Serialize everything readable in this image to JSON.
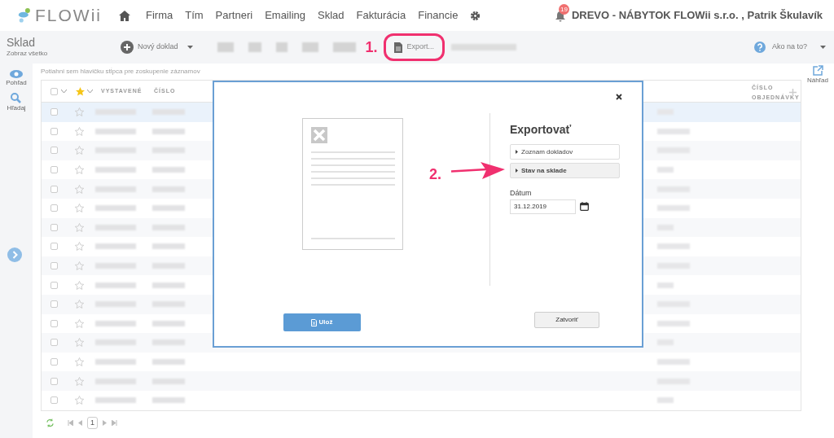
{
  "nav": {
    "logo": "FLOWii",
    "items": [
      "Firma",
      "Tím",
      "Partneri",
      "Emailing",
      "Sklad",
      "Fakturácia",
      "Financie"
    ],
    "notification_count": "19",
    "user": "DREVO - NÁBYTOK FLOWii s.r.o. , Patrik Škulavík"
  },
  "toolbar": {
    "title": "Sklad",
    "subtitle": "Zobraz všetko",
    "new_button": "Nový doklad",
    "export_button": "Export...",
    "help": "Ako na to?"
  },
  "left_rail": [
    "Pohľad",
    "Hľadaj"
  ],
  "right_rail": "Náhľad",
  "table": {
    "group_hint": "Potiahni sem hlavičku stĺpca pre zoskupenie záznamov",
    "columns": [
      "VYSTAVENÉ",
      "ČÍSLO"
    ],
    "last_column": [
      "ČÍSLO",
      "OBJEDNÁVKY"
    ],
    "rows": [
      {
        "selected": true,
        "checked": false,
        "starred": false
      },
      {
        "selected": false,
        "checked": false,
        "starred": false
      },
      {
        "selected": false,
        "checked": false,
        "starred": false
      },
      {
        "selected": false,
        "checked": false,
        "starred": false
      },
      {
        "selected": false,
        "checked": false,
        "starred": false
      },
      {
        "selected": false,
        "checked": false,
        "starred": false
      },
      {
        "selected": false,
        "checked": false,
        "starred": false
      },
      {
        "selected": false,
        "checked": false,
        "starred": false
      },
      {
        "selected": false,
        "checked": false,
        "starred": false
      },
      {
        "selected": false,
        "checked": false,
        "starred": false
      },
      {
        "selected": false,
        "checked": false,
        "starred": false
      },
      {
        "selected": false,
        "checked": false,
        "starred": false
      },
      {
        "selected": false,
        "checked": false,
        "starred": false
      },
      {
        "selected": false,
        "checked": false,
        "starred": false
      },
      {
        "selected": false,
        "checked": false,
        "starred": false
      },
      {
        "selected": false,
        "checked": false,
        "starred": false
      }
    ],
    "page": "1",
    "select_all_checked": false
  },
  "dialog": {
    "title": "Exportovať",
    "options": [
      {
        "label": "Zoznam dokladov",
        "selected": false
      },
      {
        "label": "Stav na sklade",
        "selected": true
      }
    ],
    "date_label": "Dátum",
    "date_value": "31.12.2019",
    "save_button": "Ulož",
    "close_button": "Zatvoriť"
  },
  "annotations": [
    "1.",
    "2."
  ]
}
